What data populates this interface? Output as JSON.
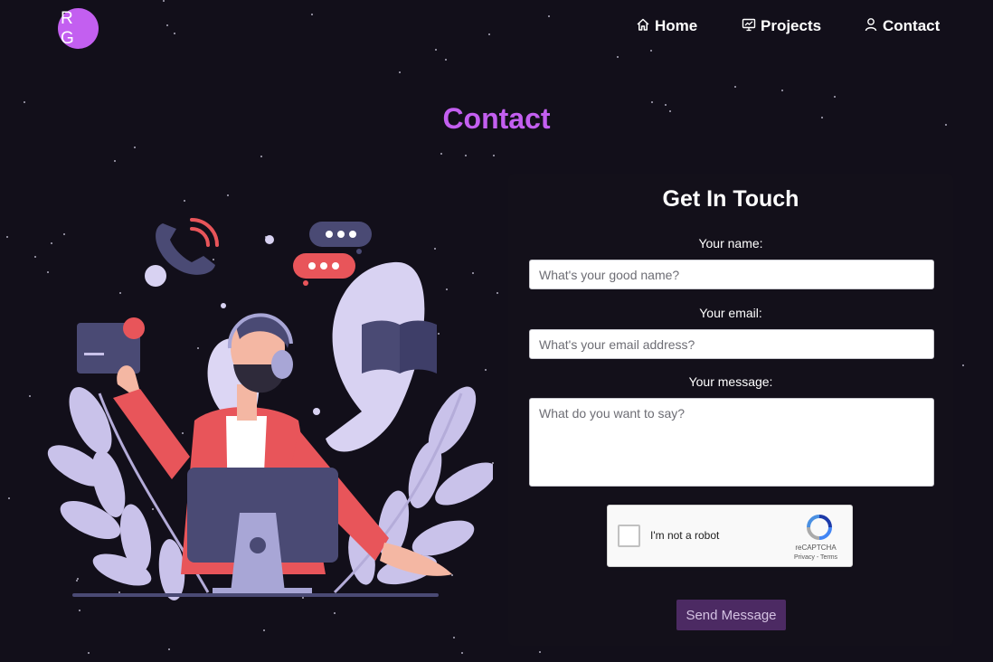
{
  "logo": {
    "initials": "R G",
    "color": "#c35ff0"
  },
  "nav": {
    "items": [
      {
        "label": "Home",
        "icon": "home-icon"
      },
      {
        "label": "Projects",
        "icon": "presentation-icon"
      },
      {
        "label": "Contact",
        "icon": "user-icon"
      }
    ]
  },
  "page": {
    "title": "Contact",
    "accent_color": "#c35ff0",
    "background": "#120f1a"
  },
  "form": {
    "title": "Get In Touch",
    "name": {
      "label": "Your name:",
      "placeholder": "What's your good name?"
    },
    "email": {
      "label": "Your email:",
      "placeholder": "What's your email address?"
    },
    "message": {
      "label": "Your message:",
      "placeholder": "What do you want to say?"
    },
    "recaptcha": {
      "label": "I'm not a robot",
      "brand": "reCAPTCHA",
      "links": "Privacy - Terms"
    },
    "submit_label": "Send Message",
    "submit_color": "#4c2a63"
  }
}
